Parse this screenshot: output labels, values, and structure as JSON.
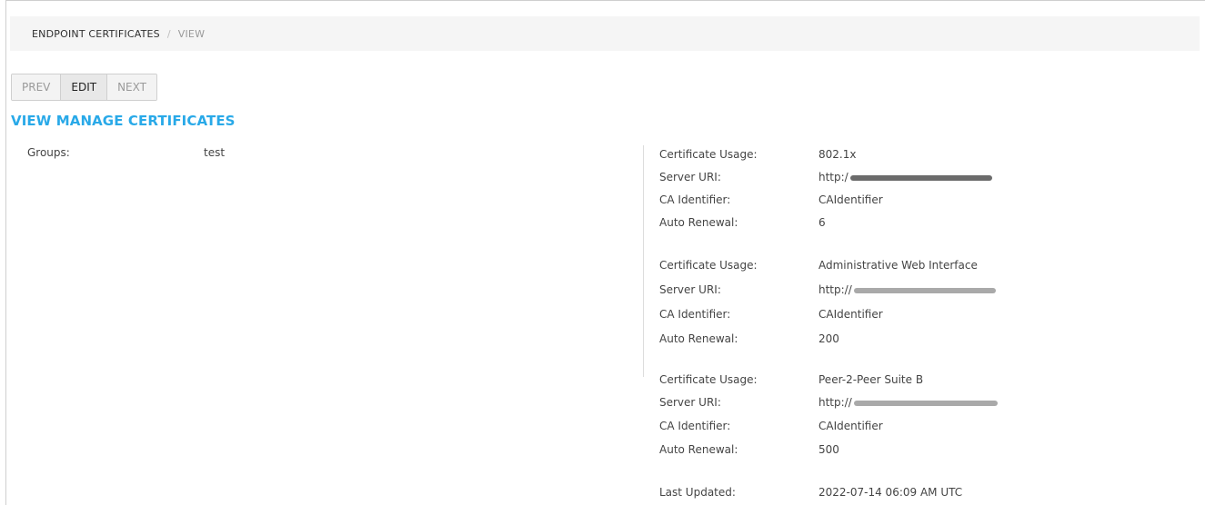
{
  "breadcrumb": {
    "parent": "ENDPOINT CERTIFICATES",
    "separator": "/",
    "current": "VIEW"
  },
  "toolbar": {
    "prev_label": "PREV",
    "edit_label": "EDIT",
    "next_label": "NEXT"
  },
  "page": {
    "title": "VIEW MANAGE CERTIFICATES"
  },
  "groups": {
    "label": "Groups:",
    "value": "test"
  },
  "certificates": [
    {
      "usage_label": "Certificate Usage:",
      "usage_value": "802.1x",
      "server_uri_label": "Server URI:",
      "server_uri_value": "http:/",
      "ca_identifier_label": "CA Identifier:",
      "ca_identifier_value": "CAIdentifier",
      "auto_renewal_label": "Auto Renewal:",
      "auto_renewal_value": "6"
    },
    {
      "usage_label": "Certificate Usage:",
      "usage_value": "Administrative Web Interface",
      "server_uri_label": "Server URI:",
      "server_uri_value": "http://",
      "ca_identifier_label": "CA Identifier:",
      "ca_identifier_value": "CAIdentifier",
      "auto_renewal_label": "Auto Renewal:",
      "auto_renewal_value": "200"
    },
    {
      "usage_label": "Certificate Usage:",
      "usage_value": "Peer-2-Peer Suite B",
      "server_uri_label": "Server URI:",
      "server_uri_value": "http://",
      "ca_identifier_label": "CA Identifier:",
      "ca_identifier_value": "CAIdentifier",
      "auto_renewal_label": "Auto Renewal:",
      "auto_renewal_value": "500"
    }
  ],
  "last_updated": {
    "label": "Last Updated:",
    "value": "2022-07-14 06:09 AM UTC"
  },
  "colors": {
    "title": "#29a9e8",
    "breadcrumb_bg": "#f5f5f5"
  }
}
